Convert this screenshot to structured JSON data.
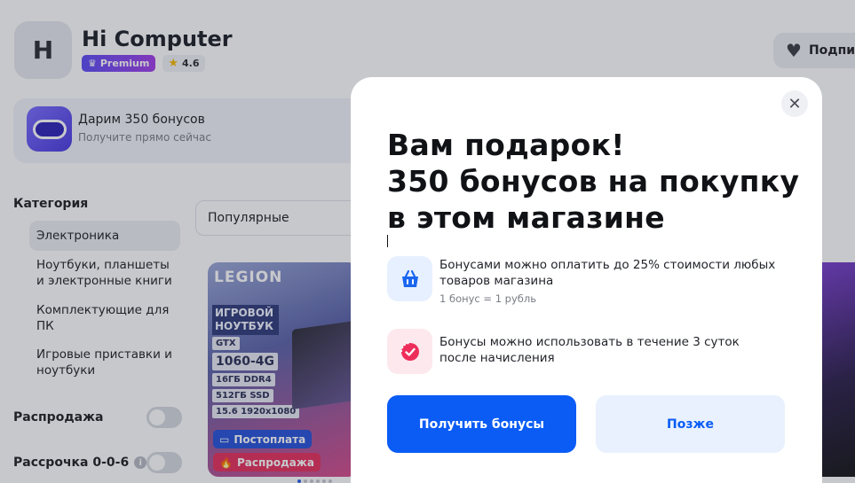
{
  "store": {
    "logo_letter": "H",
    "name": "Hi Computer",
    "premium_label": "Premium",
    "rating": "4.6",
    "subscribe_label": "Подпис"
  },
  "promo_banner": {
    "title": "Дарим 350 бонусов",
    "subtitle": "Получите прямо сейчас"
  },
  "sidebar": {
    "heading": "Категория",
    "items": [
      {
        "label": "Электроника",
        "active": true
      },
      {
        "label": "Ноутбуки, планшеты и электронные книги",
        "active": false
      },
      {
        "label": "Комплектующие для ПК",
        "active": false
      },
      {
        "label": "Игровые приставки и ноутбуки",
        "active": false
      }
    ],
    "toggles": [
      {
        "label": "Распродажа",
        "on": false
      },
      {
        "label": "Рассрочка 0-0-6",
        "on": false
      }
    ]
  },
  "sort": {
    "value": "Популярные"
  },
  "product_card": {
    "brand": "LEGION",
    "tag": "ИГРОВОЙ НОУТБУК",
    "specs": [
      "GTX",
      "1060-4G",
      "16ГБ DDR4",
      "512ГБ SSD",
      "15.6 1920x1080"
    ],
    "labels": {
      "installment": "Постоплата",
      "sale": "Распродажа"
    }
  },
  "modal": {
    "title": "Вам подарок!\n350 бонусов на покупку\nв этом магазине",
    "benefit_1": {
      "text": "Бонусами можно оплатить до 25% стоимости любых товаров магазина",
      "note": "1 бонус = 1 рубль"
    },
    "benefit_2": {
      "text": "Бонусы можно использовать в течение 3 суток после начисления"
    },
    "primary_button": "Получить бонусы",
    "secondary_button": "Позже"
  },
  "colors": {
    "primary": "#0a5cf5",
    "secondary_bg": "#e8f1fd",
    "premium_start": "#5b4cf5",
    "premium_end": "#a23ee8",
    "sale": "#e6305c"
  },
  "icons": {
    "close": "close-icon",
    "basket": "basket-icon",
    "timer": "timer-check-icon",
    "heart": "heart-icon",
    "star": "star-icon",
    "crown": "crown-icon"
  }
}
